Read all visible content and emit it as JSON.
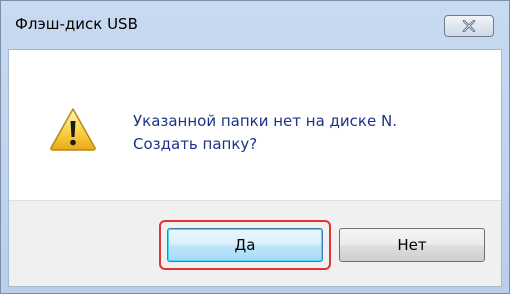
{
  "dialog": {
    "title": "Флэш-диск USB",
    "message_line1": "Указанной папки нет на диске N.",
    "message_line2": "Создать папку?",
    "icon": "warning-icon"
  },
  "buttons": {
    "yes_label": "Да",
    "no_label": "Нет"
  },
  "colors": {
    "message_text": "#1e3287",
    "highlight": "#e0343a",
    "titlebar": "#c8daf0"
  }
}
